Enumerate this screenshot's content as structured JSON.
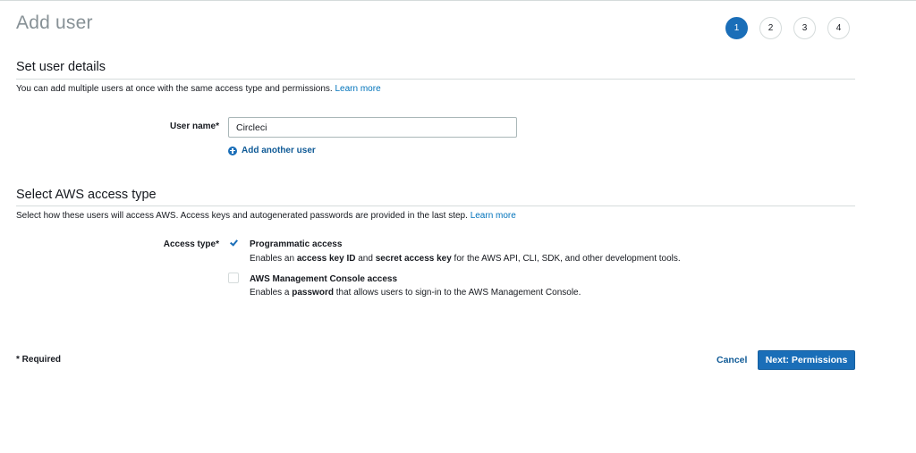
{
  "page": {
    "title": "Add user"
  },
  "steps": [
    "1",
    "2",
    "3",
    "4"
  ],
  "user_details": {
    "title": "Set user details",
    "description": "You can add multiple users at once with the same access type and permissions.",
    "learn_more": "Learn more",
    "user_name_label": "User name*",
    "user_name_value": "Circleci",
    "add_another": "Add another user"
  },
  "access_type": {
    "title": "Select AWS access type",
    "description": "Select how these users will access AWS. Access keys and autogenerated passwords are provided in the last step.",
    "learn_more": "Learn more",
    "label": "Access type*",
    "options": [
      {
        "title": "Programmatic access",
        "checked": true,
        "desc_1": "Enables an ",
        "desc_b1": "access key ID",
        "desc_2": " and ",
        "desc_b2": "secret access key",
        "desc_3": " for the AWS API, CLI, SDK, and other development tools."
      },
      {
        "title": "AWS Management Console access",
        "checked": false,
        "desc_1": "Enables a ",
        "desc_b1": "password",
        "desc_2": " that allows users to sign-in to the AWS Management Console."
      }
    ]
  },
  "footer": {
    "required": "* Required",
    "cancel": "Cancel",
    "next": "Next: Permissions"
  },
  "colors": {
    "primary": "#1a6eb8",
    "link": "#0073bb",
    "border": "#d5dbdb",
    "title_gray": "#879196"
  },
  "icons": {
    "add": "plus-circle-icon",
    "check": "checkmark-icon"
  }
}
